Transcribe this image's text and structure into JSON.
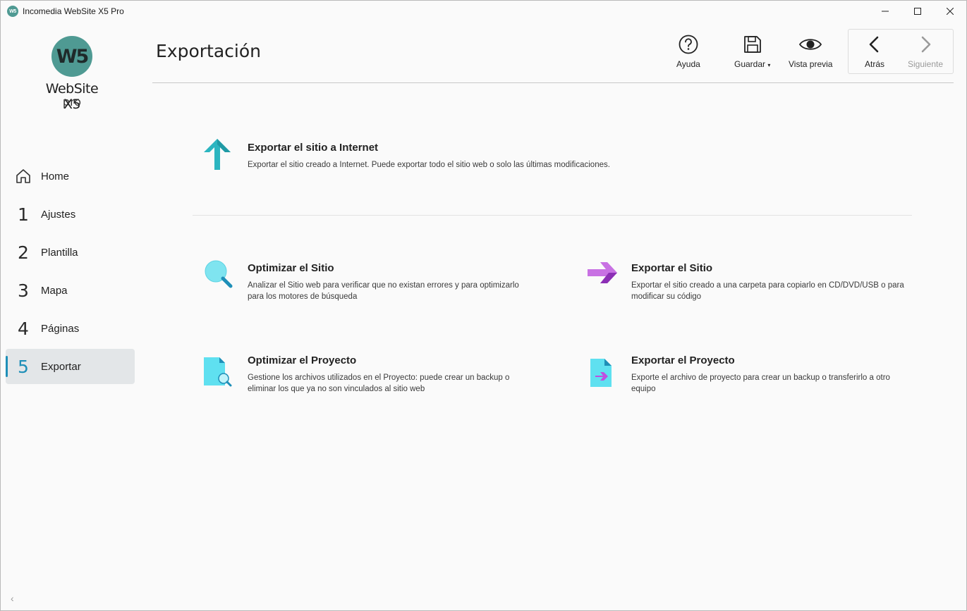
{
  "window": {
    "title": "Incomedia WebSite X5 Pro",
    "app_icon_text": "W5"
  },
  "logo": {
    "mark": "W5",
    "name": "WebSite X5",
    "edition": "pro"
  },
  "sidebar": {
    "items": [
      {
        "num": "",
        "icon": "home-icon",
        "label": "Home"
      },
      {
        "num": "1",
        "label": "Ajustes"
      },
      {
        "num": "2",
        "label": "Plantilla"
      },
      {
        "num": "3",
        "label": "Mapa"
      },
      {
        "num": "4",
        "label": "Páginas"
      },
      {
        "num": "5",
        "label": "Exportar",
        "active": true
      }
    ],
    "collapse_glyph": "‹"
  },
  "header": {
    "title": "Exportación",
    "buttons": {
      "help": "Ayuda",
      "save": "Guardar",
      "preview": "Vista previa",
      "back": "Atrás",
      "next": "Siguiente"
    }
  },
  "content": {
    "export_internet": {
      "title": "Exportar el sitio a Internet",
      "desc": "Exportar el sitio creado a Internet. Puede exportar todo el sitio web o solo las últimas modificaciones."
    },
    "optimize_site": {
      "title": "Optimizar el Sitio",
      "desc": "Analizar el Sitio web para verificar que no existan errores y para optimizarlo para los motores de búsqueda"
    },
    "export_site": {
      "title": "Exportar el Sitio",
      "desc": "Exportar el sitio creado a una carpeta para copiarlo en CD/DVD/USB o para modificar su código"
    },
    "optimize_project": {
      "title": "Optimizar el Proyecto",
      "desc": "Gestione los archivos utilizados en el Proyecto: puede crear un backup o eliminar los que ya no son vinculados al sitio web"
    },
    "export_project": {
      "title": "Exportar el Proyecto",
      "desc": "Exporte el archivo de proyecto para crear un backup o transferirlo a otro equipo"
    }
  },
  "colors": {
    "accent": "#1e8fb8",
    "teal": "#2bb5c0",
    "purple": "#b54fd6",
    "logo": "#4f9a93"
  }
}
